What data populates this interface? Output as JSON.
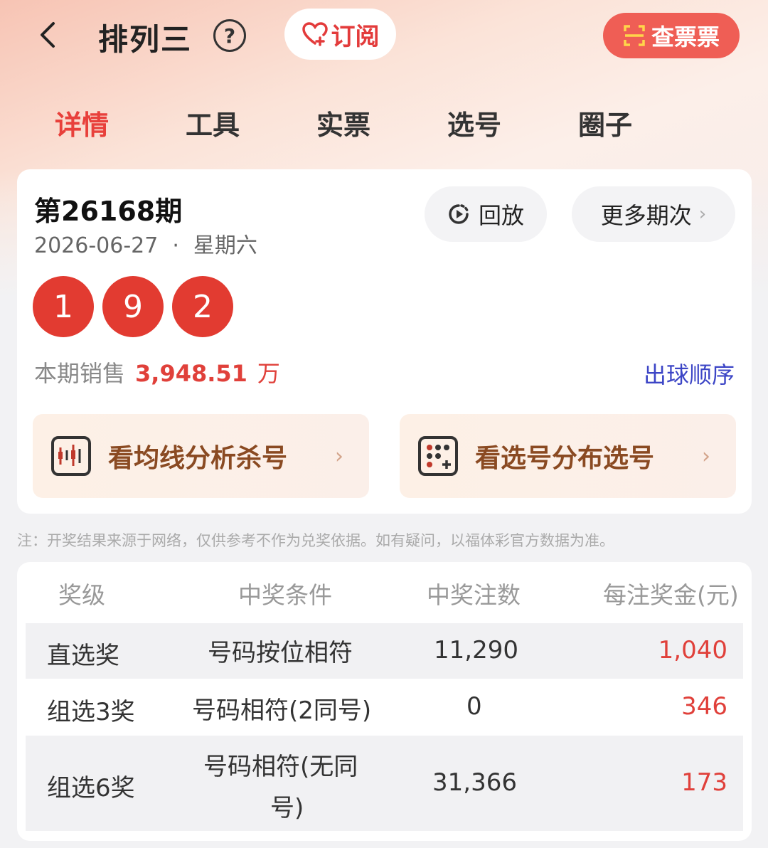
{
  "header": {
    "title": "排列三",
    "subscribe_label": "订阅",
    "check_ticket_label": "查票票"
  },
  "tabs": [
    {
      "label": "详情",
      "active": true
    },
    {
      "label": "工具",
      "active": false
    },
    {
      "label": "实票",
      "active": false
    },
    {
      "label": "选号",
      "active": false
    },
    {
      "label": "圈子",
      "active": false
    }
  ],
  "draw": {
    "period": "第26168期",
    "date": "2026-06-27",
    "separator": "·",
    "weekday": "星期六",
    "replay_label": "回放",
    "more_label": "更多期次",
    "numbers": [
      "1",
      "9",
      "2"
    ],
    "sales_label": "本期销售",
    "sales_value": "3,948.51",
    "sales_unit": "万",
    "order_link": "出球顺序"
  },
  "promos": [
    {
      "label": "看均线分析杀号"
    },
    {
      "label": "看选号分布选号"
    }
  ],
  "note": "注：开奖结果来源于网络，仅供参考不作为兑奖依据。如有疑问，以福体彩官方数据为准。",
  "prize_table": {
    "headers": [
      "奖级",
      "中奖条件",
      "中奖注数",
      "每注奖金(元)"
    ],
    "rows": [
      {
        "level": "直选奖",
        "condition": "号码按位相符",
        "count": "11,290",
        "amount": "1,040"
      },
      {
        "level": "组选3奖",
        "condition": "号码相符(2同号)",
        "count": "0",
        "amount": "346"
      },
      {
        "level": "组选6奖",
        "condition_line1": "号码相符(无同",
        "condition_line2": "号)",
        "count": "31,366",
        "amount": "173"
      }
    ]
  },
  "colors": {
    "accent_red": "#e23b31",
    "link_blue": "#3c45c6",
    "check_btn": "#ef5e55"
  }
}
